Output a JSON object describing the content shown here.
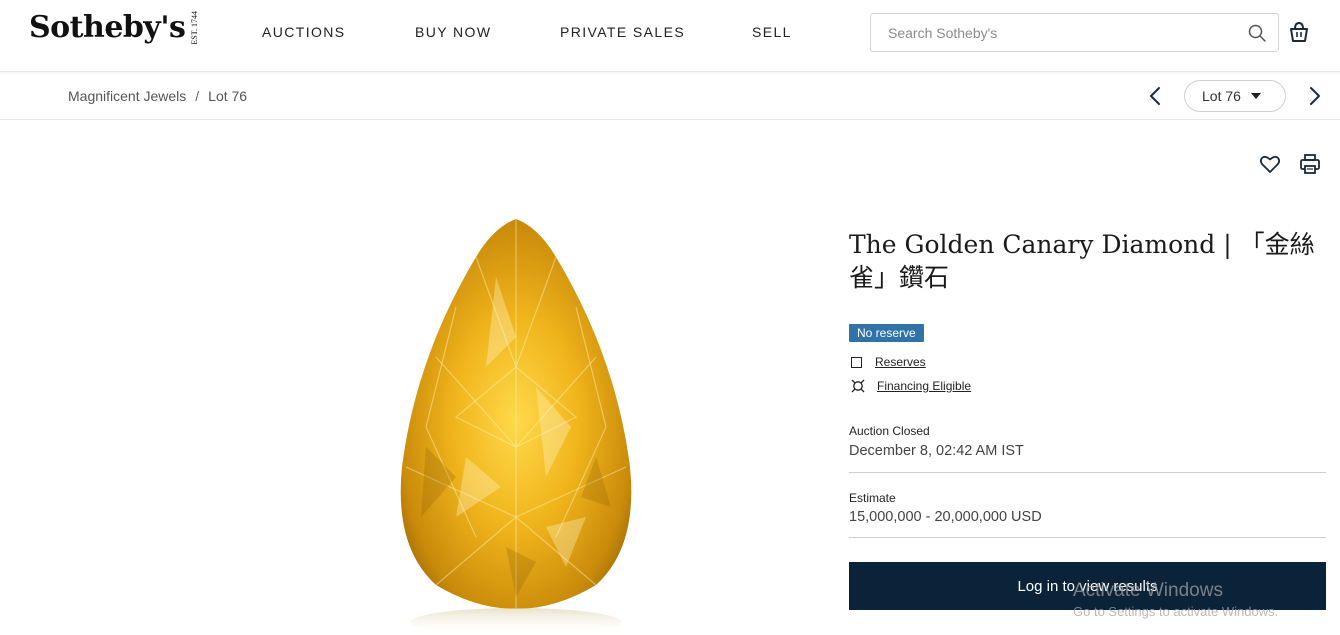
{
  "header": {
    "logo": "Sotheby's",
    "logo_est": "EST. 1744",
    "nav": [
      "AUCTIONS",
      "BUY NOW",
      "PRIVATE SALES",
      "SELL"
    ],
    "search_placeholder": "Search Sotheby's",
    "search_icon": "search-icon",
    "bag_icon": "shopping-bag-icon"
  },
  "breadcrumb": {
    "parent": "Magnificent Jewels",
    "separator": "/",
    "current": "Lot 76"
  },
  "lot_nav": {
    "selected": "Lot 76",
    "prev_icon": "chevron-left-icon",
    "next_icon": "chevron-right-icon"
  },
  "actions": {
    "favorite_icon": "heart-icon",
    "print_icon": "print-icon"
  },
  "lot": {
    "title": "The Golden Canary Diamond | 「金絲雀」鑽石",
    "badge": "No reserve",
    "reserves_link": "Reserves",
    "financing_link": "Financing Eligible",
    "status_label": "Auction Closed",
    "closed_at": "December 8, 02:42 AM IST",
    "estimate_label": "Estimate",
    "estimate_value": "15,000,000 - 20,000,000 USD",
    "cta": "Log in to view results",
    "image": "yellow-pear-shaped-diamond"
  },
  "watermark": {
    "line1": "Activate Windows",
    "line2": "Go to Settings to activate Windows."
  },
  "colors": {
    "badge": "#2f73a8",
    "cta_bg": "#0b2338",
    "diamond": "#e8b71e"
  }
}
